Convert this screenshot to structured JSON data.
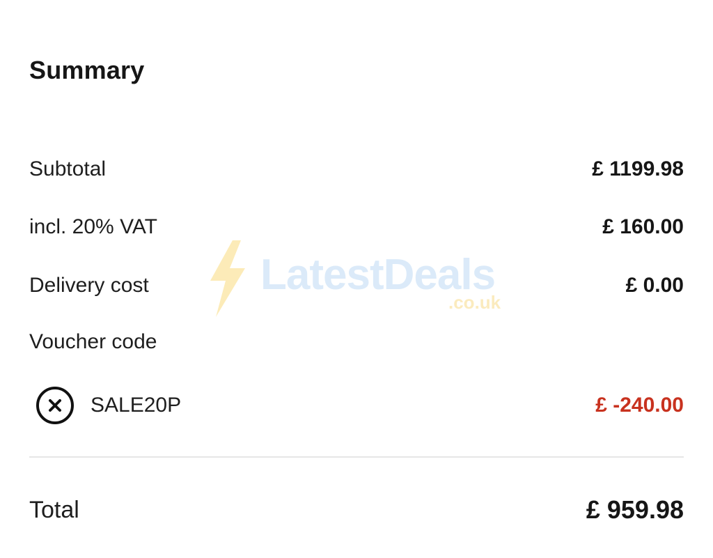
{
  "summary": {
    "title": "Summary",
    "subtotal": {
      "label": "Subtotal",
      "value": "£ 1199.98"
    },
    "vat": {
      "label": "incl. 20% VAT",
      "value": "£ 160.00"
    },
    "delivery": {
      "label": "Delivery cost",
      "value": "£ 0.00"
    },
    "voucher": {
      "label": "Voucher code",
      "code": "SALE20P",
      "value": "£ -240.00",
      "remove_icon": "close-circle-icon"
    },
    "total": {
      "label": "Total",
      "value": "£ 959.98"
    }
  },
  "watermark": {
    "brand": "LatestDeals",
    "suffix": ".co.uk"
  },
  "colors": {
    "discount": "#c8321f",
    "text": "#1a1a1a",
    "divider": "#e6e6e6"
  }
}
